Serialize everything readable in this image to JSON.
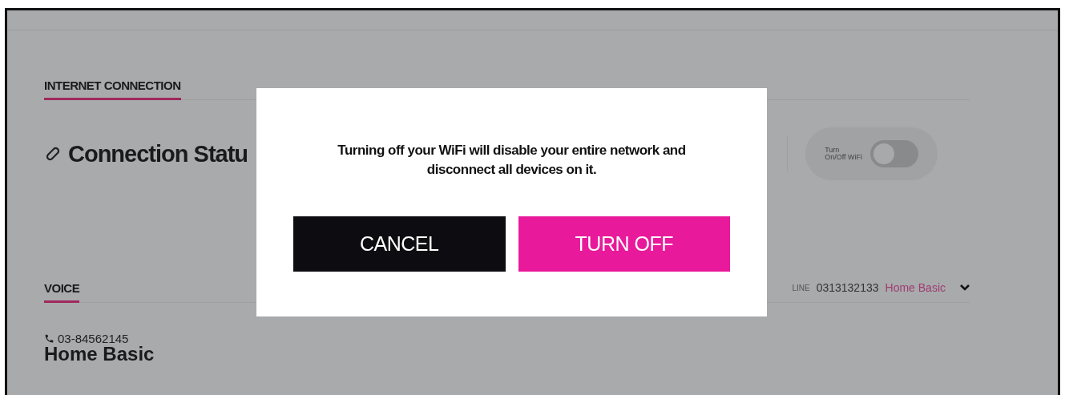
{
  "internet_section": {
    "heading": "INTERNET CONNECTION",
    "status_title": "Connection Statu",
    "wifi_toggle": {
      "label_line1": "Turn",
      "label_line2": "On/Off WiFi",
      "on": false
    }
  },
  "voice_section": {
    "heading": "VOICE",
    "line_label": "LINE",
    "line_number": "0313132133",
    "plan": "Home Basic",
    "expanded": false,
    "phone": "03-84562145",
    "phone_plan": "Home Basic"
  },
  "dialog": {
    "message": "Turning off your WiFi will disable your entire network and disconnect all devices on it.",
    "buttons": [
      {
        "label": "CANCEL",
        "kind": "secondary"
      },
      {
        "label": "TURN OFF",
        "kind": "primary"
      }
    ]
  }
}
